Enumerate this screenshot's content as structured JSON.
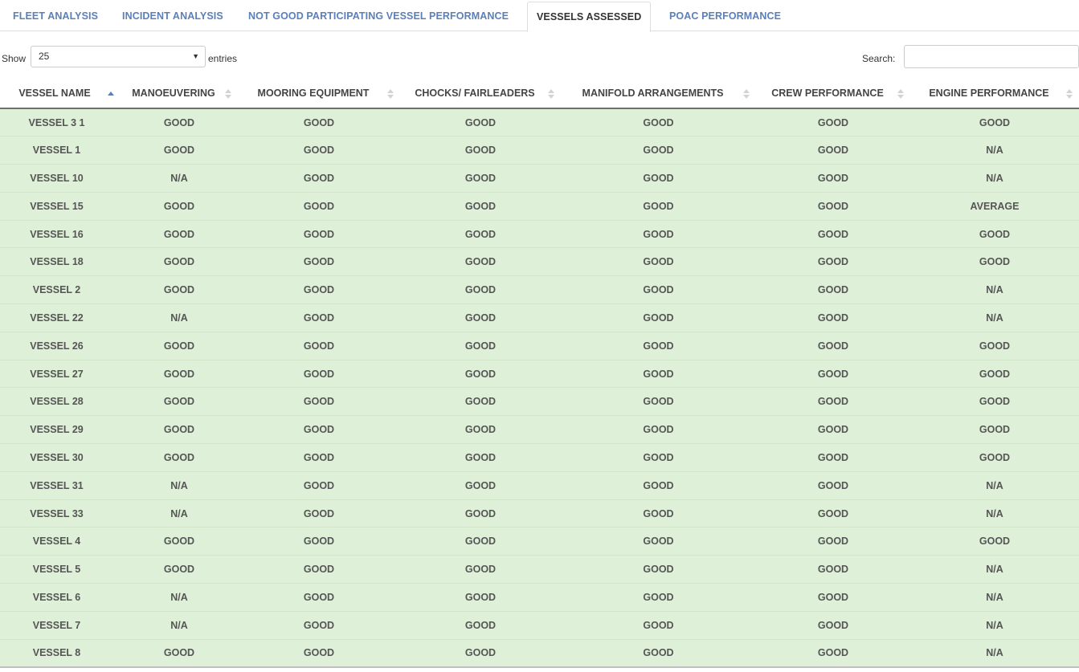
{
  "tabs": [
    {
      "label": "FLEET ANALYSIS",
      "active": false
    },
    {
      "label": "INCIDENT ANALYSIS",
      "active": false
    },
    {
      "label": "NOT GOOD PARTICIPATING VESSEL PERFORMANCE",
      "active": false
    },
    {
      "label": "VESSELS ASSESSED",
      "active": true
    },
    {
      "label": "POAC PERFORMANCE",
      "active": false
    }
  ],
  "controls": {
    "show_label": "Show",
    "entries_value": "25",
    "entries_label": "entries",
    "search_label": "Search:",
    "search_value": ""
  },
  "table": {
    "headers": [
      "VESSEL NAME",
      "MANOEUVERING",
      "MOORING EQUIPMENT",
      "CHOCKS/ FAIRLEADERS",
      "MANIFOLD ARRANGEMENTS",
      "CREW PERFORMANCE",
      "ENGINE PERFORMANCE"
    ],
    "sorted_column": "VESSEL NAME",
    "sort_direction": "ascending",
    "row_color": "#dff0d8",
    "rows": [
      [
        "VESSEL 3 1",
        "GOOD",
        "GOOD",
        "GOOD",
        "GOOD",
        "GOOD",
        "GOOD"
      ],
      [
        "VESSEL 1",
        "GOOD",
        "GOOD",
        "GOOD",
        "GOOD",
        "GOOD",
        "N/A"
      ],
      [
        "VESSEL 10",
        "N/A",
        "GOOD",
        "GOOD",
        "GOOD",
        "GOOD",
        "N/A"
      ],
      [
        "VESSEL 15",
        "GOOD",
        "GOOD",
        "GOOD",
        "GOOD",
        "GOOD",
        "AVERAGE"
      ],
      [
        "VESSEL 16",
        "GOOD",
        "GOOD",
        "GOOD",
        "GOOD",
        "GOOD",
        "GOOD"
      ],
      [
        "VESSEL 18",
        "GOOD",
        "GOOD",
        "GOOD",
        "GOOD",
        "GOOD",
        "GOOD"
      ],
      [
        "VESSEL 2",
        "GOOD",
        "GOOD",
        "GOOD",
        "GOOD",
        "GOOD",
        "N/A"
      ],
      [
        "VESSEL 22",
        "N/A",
        "GOOD",
        "GOOD",
        "GOOD",
        "GOOD",
        "N/A"
      ],
      [
        "VESSEL 26",
        "GOOD",
        "GOOD",
        "GOOD",
        "GOOD",
        "GOOD",
        "GOOD"
      ],
      [
        "VESSEL 27",
        "GOOD",
        "GOOD",
        "GOOD",
        "GOOD",
        "GOOD",
        "GOOD"
      ],
      [
        "VESSEL 28",
        "GOOD",
        "GOOD",
        "GOOD",
        "GOOD",
        "GOOD",
        "GOOD"
      ],
      [
        "VESSEL 29",
        "GOOD",
        "GOOD",
        "GOOD",
        "GOOD",
        "GOOD",
        "GOOD"
      ],
      [
        "VESSEL 30",
        "GOOD",
        "GOOD",
        "GOOD",
        "GOOD",
        "GOOD",
        "GOOD"
      ],
      [
        "VESSEL 31",
        "N/A",
        "GOOD",
        "GOOD",
        "GOOD",
        "GOOD",
        "N/A"
      ],
      [
        "VESSEL 33",
        "N/A",
        "GOOD",
        "GOOD",
        "GOOD",
        "GOOD",
        "N/A"
      ],
      [
        "VESSEL 4",
        "GOOD",
        "GOOD",
        "GOOD",
        "GOOD",
        "GOOD",
        "GOOD"
      ],
      [
        "VESSEL 5",
        "GOOD",
        "GOOD",
        "GOOD",
        "GOOD",
        "GOOD",
        "N/A"
      ],
      [
        "VESSEL 6",
        "N/A",
        "GOOD",
        "GOOD",
        "GOOD",
        "GOOD",
        "N/A"
      ],
      [
        "VESSEL 7",
        "N/A",
        "GOOD",
        "GOOD",
        "GOOD",
        "GOOD",
        "N/A"
      ],
      [
        "VESSEL 8",
        "GOOD",
        "GOOD",
        "GOOD",
        "GOOD",
        "GOOD",
        "N/A"
      ]
    ]
  }
}
